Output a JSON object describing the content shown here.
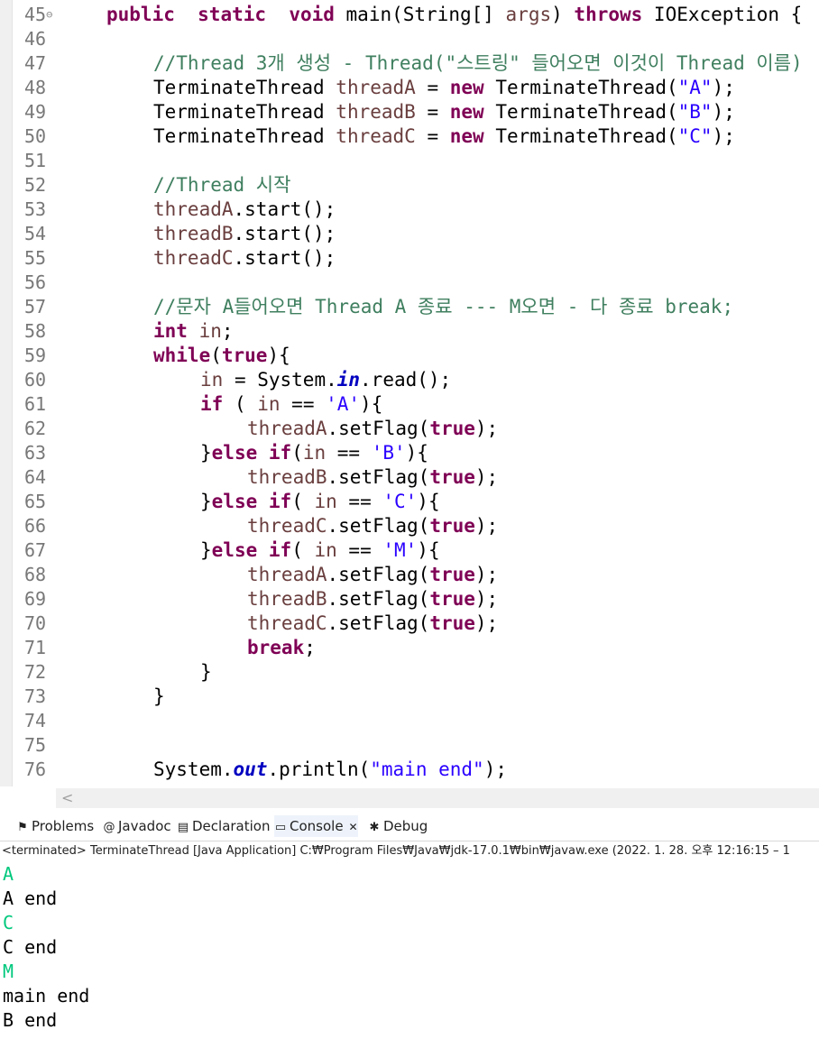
{
  "editor": {
    "fold_icon": "⊖",
    "lines": [
      {
        "n": "45",
        "fold": true,
        "indent": 0,
        "tokens": [
          [
            "kw",
            "public"
          ],
          [
            "",
            "  "
          ],
          [
            "kw",
            "static"
          ],
          [
            "",
            "  "
          ],
          [
            "kw",
            "void"
          ],
          [
            "",
            " main(String[] "
          ],
          [
            "pa",
            "args"
          ],
          [
            "",
            ") "
          ],
          [
            "kw",
            "throws"
          ],
          [
            "",
            " IOException {"
          ]
        ]
      },
      {
        "n": "46",
        "indent": 0,
        "tokens": []
      },
      {
        "n": "47",
        "indent": 1,
        "tokens": [
          [
            "cm",
            "//Thread 3개 생성 - Thread(\"스트링\" 들어오면 이것이 Thread 이름)"
          ]
        ]
      },
      {
        "n": "48",
        "indent": 1,
        "tokens": [
          [
            "",
            "TerminateThread "
          ],
          [
            "pa",
            "threadA"
          ],
          [
            "",
            " = "
          ],
          [
            "kw",
            "new"
          ],
          [
            "",
            " TerminateThread("
          ],
          [
            "st",
            "\"A\""
          ],
          [
            "",
            ");"
          ]
        ]
      },
      {
        "n": "49",
        "indent": 1,
        "tokens": [
          [
            "",
            "TerminateThread "
          ],
          [
            "pa",
            "threadB"
          ],
          [
            "",
            " = "
          ],
          [
            "kw",
            "new"
          ],
          [
            "",
            " TerminateThread("
          ],
          [
            "st",
            "\"B\""
          ],
          [
            "",
            ");"
          ]
        ]
      },
      {
        "n": "50",
        "indent": 1,
        "tokens": [
          [
            "",
            "TerminateThread "
          ],
          [
            "pa",
            "threadC"
          ],
          [
            "",
            " = "
          ],
          [
            "kw",
            "new"
          ],
          [
            "",
            " TerminateThread("
          ],
          [
            "st",
            "\"C\""
          ],
          [
            "",
            ");"
          ]
        ]
      },
      {
        "n": "51",
        "indent": 0,
        "tokens": []
      },
      {
        "n": "52",
        "indent": 1,
        "tokens": [
          [
            "cm",
            "//Thread 시작"
          ]
        ]
      },
      {
        "n": "53",
        "indent": 1,
        "tokens": [
          [
            "pa",
            "threadA"
          ],
          [
            "",
            ".start();"
          ]
        ]
      },
      {
        "n": "54",
        "indent": 1,
        "tokens": [
          [
            "pa",
            "threadB"
          ],
          [
            "",
            ".start();"
          ]
        ]
      },
      {
        "n": "55",
        "indent": 1,
        "tokens": [
          [
            "pa",
            "threadC"
          ],
          [
            "",
            ".start();"
          ]
        ]
      },
      {
        "n": "56",
        "indent": 0,
        "tokens": []
      },
      {
        "n": "57",
        "indent": 1,
        "tokens": [
          [
            "cm",
            "//문자 A들어오면 Thread A 종료 --- M오면 - 다 종료 break;"
          ]
        ]
      },
      {
        "n": "58",
        "indent": 1,
        "tokens": [
          [
            "kw",
            "int"
          ],
          [
            "",
            " "
          ],
          [
            "pa",
            "in"
          ],
          [
            "",
            ";"
          ]
        ]
      },
      {
        "n": "59",
        "indent": 1,
        "tokens": [
          [
            "kw",
            "while"
          ],
          [
            "",
            "("
          ],
          [
            "kw",
            "true"
          ],
          [
            "",
            "){"
          ]
        ]
      },
      {
        "n": "60",
        "indent": 2,
        "tokens": [
          [
            "pa",
            "in"
          ],
          [
            "",
            " = System."
          ],
          [
            "fi",
            "in"
          ],
          [
            "",
            ".read();"
          ]
        ]
      },
      {
        "n": "61",
        "indent": 2,
        "tokens": [
          [
            "kw",
            "if"
          ],
          [
            "",
            " ( "
          ],
          [
            "pa",
            "in"
          ],
          [
            "",
            " == "
          ],
          [
            "st",
            "'A'"
          ],
          [
            "",
            "){"
          ]
        ]
      },
      {
        "n": "62",
        "indent": 3,
        "tokens": [
          [
            "pa",
            "threadA"
          ],
          [
            "",
            ".setFlag("
          ],
          [
            "kw",
            "true"
          ],
          [
            "",
            ");"
          ]
        ]
      },
      {
        "n": "63",
        "indent": 2,
        "tokens": [
          [
            "",
            "}"
          ],
          [
            "kw",
            "else"
          ],
          [
            "",
            " "
          ],
          [
            "kw",
            "if"
          ],
          [
            "",
            "("
          ],
          [
            "pa",
            "in"
          ],
          [
            "",
            " == "
          ],
          [
            "st",
            "'B'"
          ],
          [
            "",
            "){"
          ]
        ]
      },
      {
        "n": "64",
        "indent": 3,
        "tokens": [
          [
            "pa",
            "threadB"
          ],
          [
            "",
            ".setFlag("
          ],
          [
            "kw",
            "true"
          ],
          [
            "",
            ");"
          ]
        ]
      },
      {
        "n": "65",
        "indent": 2,
        "tokens": [
          [
            "",
            "}"
          ],
          [
            "kw",
            "else"
          ],
          [
            "",
            " "
          ],
          [
            "kw",
            "if"
          ],
          [
            "",
            "( "
          ],
          [
            "pa",
            "in"
          ],
          [
            "",
            " == "
          ],
          [
            "st",
            "'C'"
          ],
          [
            "",
            "){"
          ]
        ]
      },
      {
        "n": "66",
        "indent": 3,
        "tokens": [
          [
            "pa",
            "threadC"
          ],
          [
            "",
            ".setFlag("
          ],
          [
            "kw",
            "true"
          ],
          [
            "",
            ");"
          ]
        ]
      },
      {
        "n": "67",
        "indent": 2,
        "tokens": [
          [
            "",
            "}"
          ],
          [
            "kw",
            "else"
          ],
          [
            "",
            " "
          ],
          [
            "kw",
            "if"
          ],
          [
            "",
            "( "
          ],
          [
            "pa",
            "in"
          ],
          [
            "",
            " == "
          ],
          [
            "st",
            "'M'"
          ],
          [
            "",
            "){"
          ]
        ]
      },
      {
        "n": "68",
        "indent": 3,
        "tokens": [
          [
            "pa",
            "threadA"
          ],
          [
            "",
            ".setFlag("
          ],
          [
            "kw",
            "true"
          ],
          [
            "",
            ");"
          ]
        ]
      },
      {
        "n": "69",
        "indent": 3,
        "tokens": [
          [
            "pa",
            "threadB"
          ],
          [
            "",
            ".setFlag("
          ],
          [
            "kw",
            "true"
          ],
          [
            "",
            ");"
          ]
        ]
      },
      {
        "n": "70",
        "indent": 3,
        "tokens": [
          [
            "pa",
            "threadC"
          ],
          [
            "",
            ".setFlag("
          ],
          [
            "kw",
            "true"
          ],
          [
            "",
            ");"
          ]
        ]
      },
      {
        "n": "71",
        "indent": 3,
        "tokens": [
          [
            "kw",
            "break"
          ],
          [
            "",
            ";"
          ]
        ]
      },
      {
        "n": "72",
        "indent": 2,
        "tokens": [
          [
            "",
            "}"
          ]
        ]
      },
      {
        "n": "73",
        "indent": 1,
        "tokens": [
          [
            "",
            "}"
          ]
        ]
      },
      {
        "n": "74",
        "indent": 0,
        "tokens": []
      },
      {
        "n": "75",
        "indent": 0,
        "tokens": []
      },
      {
        "n": "76",
        "indent": 1,
        "tokens": [
          [
            "",
            "System."
          ],
          [
            "fi",
            "out"
          ],
          [
            "",
            ".println("
          ],
          [
            "st",
            "\"main end\""
          ],
          [
            "",
            ");"
          ]
        ]
      }
    ]
  },
  "scrollbar": {
    "left_arrow": "<"
  },
  "views": {
    "tabs": [
      {
        "label": "Problems",
        "icon": "problems-icon",
        "glyph": "⚑",
        "active": false
      },
      {
        "label": "Javadoc",
        "icon": "javadoc-icon",
        "glyph": "@",
        "active": false
      },
      {
        "label": "Declaration",
        "icon": "declaration-icon",
        "glyph": "▤",
        "active": false
      },
      {
        "label": "Console",
        "icon": "console-icon",
        "glyph": "▭",
        "active": true,
        "close": "✕"
      },
      {
        "label": "Debug",
        "icon": "debug-icon",
        "glyph": "✱",
        "active": false
      }
    ],
    "console_header": "<terminated> TerminateThread [Java Application] C:₩Program Files₩Java₩jdk-17.0.1₩bin₩javaw.exe  (2022. 1. 28. 오후 12:16:15 – 1",
    "console_lines": [
      {
        "text": "A",
        "kind": "input"
      },
      {
        "text": "A end",
        "kind": "output"
      },
      {
        "text": "C",
        "kind": "input"
      },
      {
        "text": "C end",
        "kind": "output"
      },
      {
        "text": "M",
        "kind": "input"
      },
      {
        "text": "main end",
        "kind": "output"
      },
      {
        "text": "B end",
        "kind": "output"
      }
    ]
  }
}
